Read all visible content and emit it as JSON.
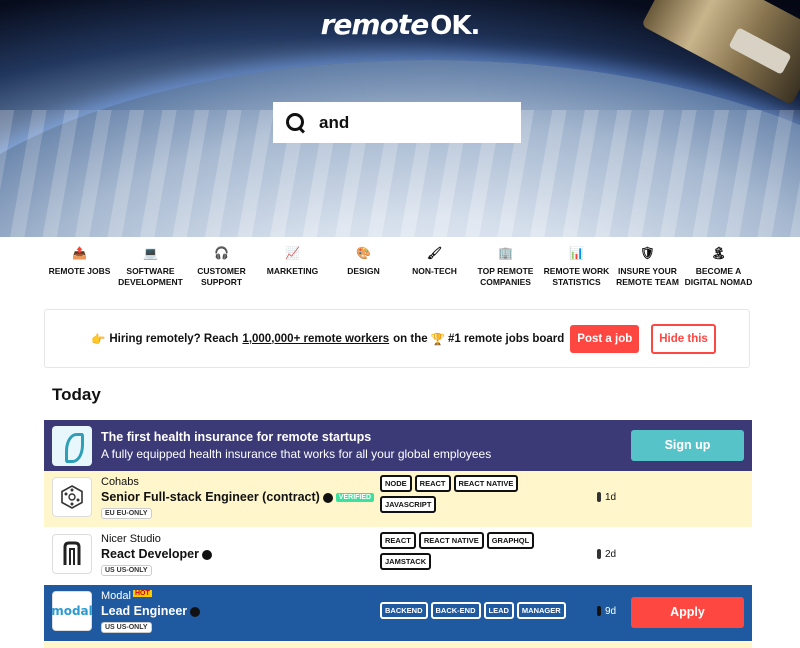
{
  "site": {
    "logo_text": "remote",
    "logo_ok": "OK."
  },
  "search": {
    "value": "and"
  },
  "nav": [
    {
      "icon": "📤",
      "label": "REMOTE JOBS"
    },
    {
      "icon": "💻",
      "label": "SOFTWARE DEVELOPMENT"
    },
    {
      "icon": "🎧",
      "label": "CUSTOMER SUPPORT"
    },
    {
      "icon": "📈",
      "label": "MARKETING"
    },
    {
      "icon": "🎨",
      "label": "DESIGN"
    },
    {
      "icon": "🖌",
      "label": "NON-TECH"
    },
    {
      "icon": "🏢",
      "label": "TOP REMOTE COMPANIES"
    },
    {
      "icon": "📊",
      "label": "REMOTE WORK STATISTICS"
    },
    {
      "icon": "🛡",
      "label": "INSURE YOUR REMOTE TEAM"
    },
    {
      "icon": "🏝",
      "label": "BECOME A DIGITAL NOMAD"
    }
  ],
  "hiring": {
    "emoji": "👉",
    "text1": "Hiring remotely? Reach",
    "highlight": "1,000,000+ remote workers",
    "text2": "on the",
    "trophy": "🏆",
    "text3": "#1 remote jobs board",
    "post_label": "Post a job",
    "hide_label": "Hide this"
  },
  "section_title": "Today",
  "promo": {
    "title": "The first health insurance for remote startups",
    "subtitle": "A fully equipped health insurance that works for all your global employees",
    "button": "Sign up"
  },
  "jobs": [
    {
      "company": "Cohabs",
      "title": "Senior Full-stack Engineer (contract)",
      "verified": "VERIFIED",
      "location": "EU EU-ONLY",
      "tags": [
        "NODE",
        "REACT",
        "REACT NATIVE",
        "JAVASCRIPT"
      ],
      "age": "1d"
    },
    {
      "company": "Nicer Studio",
      "title": "React Developer",
      "location": "US US-ONLY",
      "tags": [
        "REACT",
        "REACT NATIVE",
        "GRAPHQL",
        "JAMSTACK"
      ],
      "age": "2d"
    },
    {
      "company": "Modal",
      "hot": "HOT",
      "title": "Lead Engineer",
      "location": "US US-ONLY",
      "tags": [
        "BACKEND",
        "BACK-END",
        "LEAD",
        "MANAGER"
      ],
      "age": "9d",
      "apply": "Apply",
      "logo_text": "modal"
    }
  ]
}
